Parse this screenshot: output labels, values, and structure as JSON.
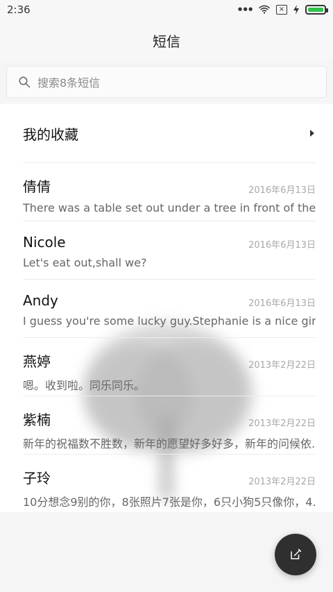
{
  "status_bar": {
    "time": "2:36",
    "battery_color": "#31c24a"
  },
  "header": {
    "title": "短信"
  },
  "search": {
    "placeholder": "搜索8条短信"
  },
  "favorites": {
    "label": "我的收藏"
  },
  "messages": [
    {
      "name": "倩倩",
      "date": "2016年6月13日",
      "preview": "There was a table set out under a tree in front of the hous"
    },
    {
      "name": "Nicole",
      "date": "2016年6月13日",
      "preview": "Let's eat out,shall we?"
    },
    {
      "name": "Andy",
      "date": "2016年6月13日",
      "preview": "I guess you're some lucky guy.Stephanie is a nice girl."
    },
    {
      "name": "燕婷",
      "date": "2013年2月22日",
      "preview": "嗯。收到啦。同乐同乐。"
    },
    {
      "name": "紫楠",
      "date": "2013年2月22日",
      "preview": "新年的祝福数不胜数，新年的愿望好多好多，新年的问候依..."
    },
    {
      "name": "子玲",
      "date": "2013年2月22日",
      "preview": "10分想念9别的你，8张照片7张是你，6只小狗5只像你，4..."
    }
  ],
  "fab": {
    "icon": "compose-icon"
  }
}
